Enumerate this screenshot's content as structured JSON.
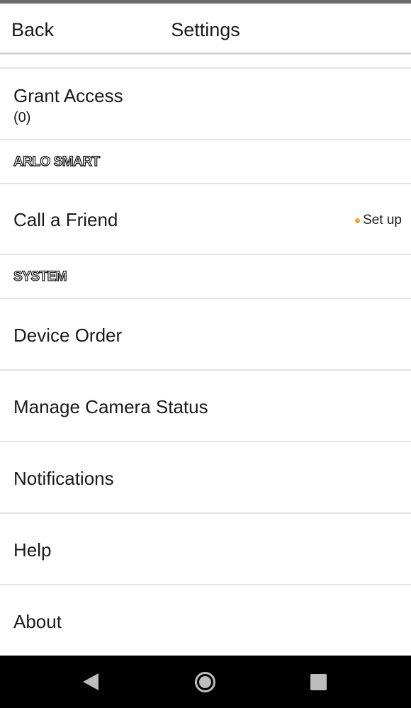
{
  "header": {
    "back_label": "Back",
    "title": "Settings"
  },
  "grant_access": {
    "label": "Grant Access",
    "count": "(0)"
  },
  "sections": {
    "arlo_smart": "ARLO SMART",
    "system": "SYSTEM"
  },
  "call_a_friend": {
    "label": "Call a Friend",
    "status": "Set up",
    "status_dot_color": "#f5a623"
  },
  "system_items": [
    {
      "label": "Device Order"
    },
    {
      "label": "Manage Camera Status"
    },
    {
      "label": "Notifications"
    },
    {
      "label": "Help"
    },
    {
      "label": "About"
    }
  ],
  "navbar": {
    "icons": [
      "back-triangle-icon",
      "home-circle-icon",
      "recent-apps-square-icon"
    ]
  }
}
